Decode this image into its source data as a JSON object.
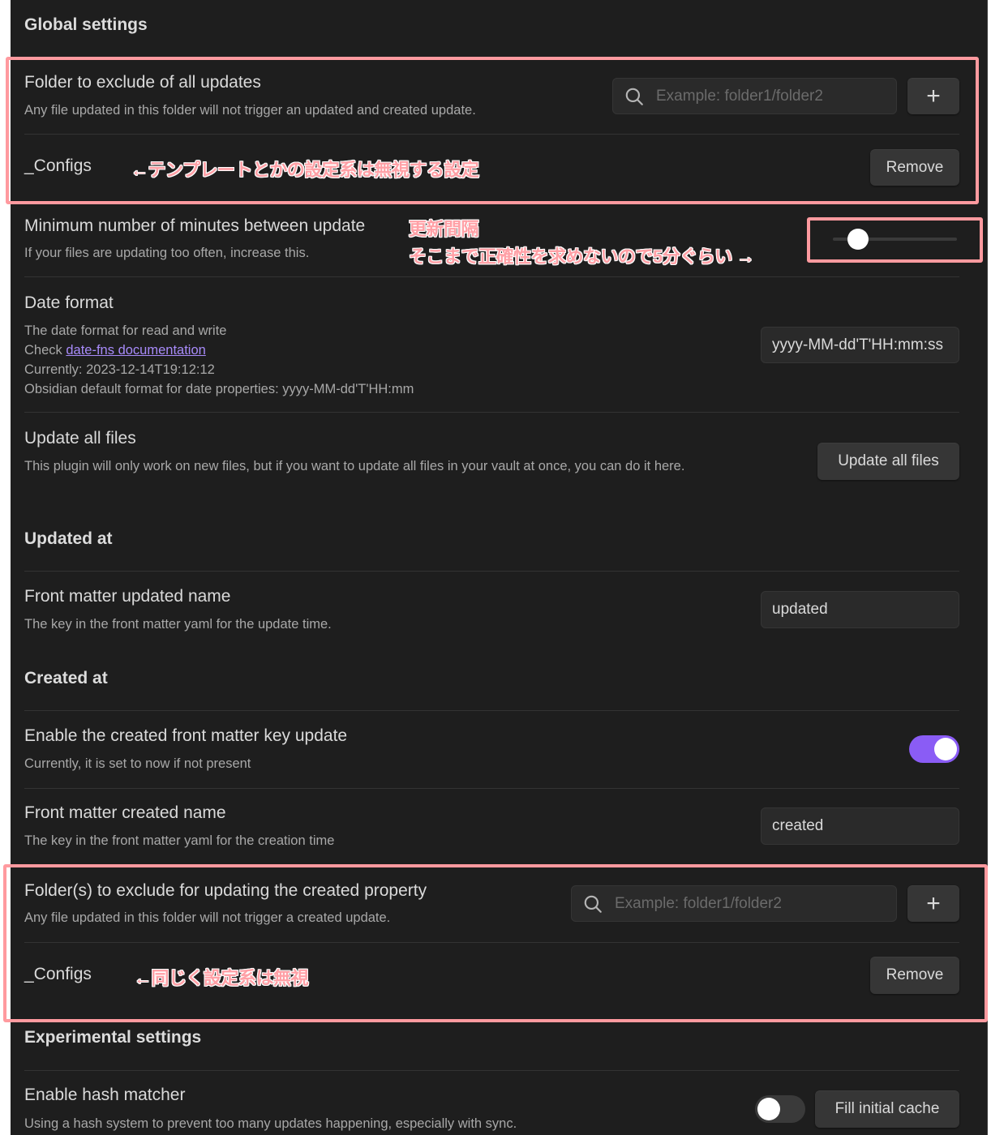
{
  "sections": {
    "global": "Global settings",
    "updated_at": "Updated at",
    "created_at": "Created at",
    "experimental": "Experimental settings"
  },
  "exclude_all": {
    "name": "Folder to exclude of all updates",
    "desc": "Any file updated in this folder will not trigger an updated and created update.",
    "search_placeholder": "Example: folder1/folder2",
    "add_label": "+",
    "folders": [
      {
        "name": "_Configs",
        "remove_label": "Remove"
      }
    ],
    "annotation": "←テンプレートとかの設定系は無視する設定"
  },
  "min_minutes": {
    "name": "Minimum number of minutes between update",
    "desc": "If your files are updating too often, increase this.",
    "slider_fraction": 0.2,
    "annotation_title": "更新間隔",
    "annotation_body": "そこまで正確性を求めないので5分ぐらい →"
  },
  "date_format": {
    "name": "Date format",
    "desc_line1": "The date format for read and write",
    "desc_check": "Check ",
    "desc_link": "date-fns documentation",
    "desc_currently": "Currently: 2023-12-14T19:12:12",
    "desc_default": "Obsidian default format for date properties: yyyy-MM-dd'T'HH:mm",
    "value": "yyyy-MM-dd'T'HH:mm:ss"
  },
  "update_all": {
    "name": "Update all files",
    "desc": "This plugin will only work on new files, but if you want to update all files in your vault at once, you can do it here.",
    "button_label": "Update all files"
  },
  "front_updated": {
    "name": "Front matter updated name",
    "desc": "The key in the front matter yaml for the update time.",
    "value": "updated"
  },
  "enable_created": {
    "name": "Enable the created front matter key update",
    "desc": "Currently, it is set to now if not present",
    "enabled": true
  },
  "front_created": {
    "name": "Front matter created name",
    "desc": "The key in the front matter yaml for the creation time",
    "value": "created"
  },
  "exclude_created": {
    "name": "Folder(s) to exclude for updating the created property",
    "desc": "Any file updated in this folder will not trigger a created update.",
    "search_placeholder": "Example: folder1/folder2",
    "add_label": "+",
    "folders": [
      {
        "name": "_Configs",
        "remove_label": "Remove"
      }
    ],
    "annotation": "←同じく設定系は無視"
  },
  "hash_matcher": {
    "name": "Enable hash matcher",
    "desc": "Using a hash system to prevent too many updates happening, especially with sync.",
    "enabled": false,
    "button_label": "Fill initial cache"
  },
  "colors": {
    "background": "#1e1e1e",
    "accent": "#8a5cf5",
    "link": "#a88bfa",
    "annotation": "#ffa0a6"
  }
}
